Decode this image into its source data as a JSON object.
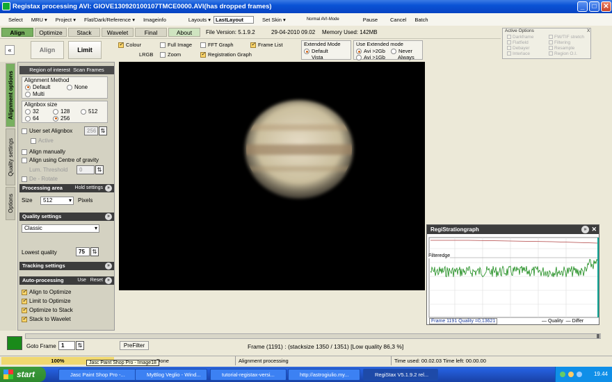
{
  "window": {
    "title": "Registax processing AVI: GIOVE130920100107TMCE0000.AVI(has dropped frames)",
    "min": "_",
    "max": "□",
    "close": "✕"
  },
  "menu": {
    "select": "Select",
    "mru": "MRU ▾",
    "project": "Project ▾",
    "flat": "Flat/Dark/Reference ▾",
    "imageinfo": "Imageinfo",
    "layouts": "Layouts ▾",
    "layout_value": "LastLayout",
    "setskin": "Set Skin ▾",
    "normal": "Normal AVI-Mode",
    "pause": "Pause",
    "cancel": "Cancel",
    "batch": "Batch"
  },
  "tabs": {
    "align": "Align",
    "optimize": "Optimize",
    "stack": "Stack",
    "wavelet": "Wavelet",
    "final": "Final",
    "about": "About",
    "version": "File Version: 5.1.9.2",
    "date": "29-04-2010 09.02",
    "memory": "Memory Used: 142MB"
  },
  "optbar": {
    "collapse": "«",
    "align_btn": "Align",
    "limit_btn": "Limit",
    "colour": "Colour",
    "fullimage": "Full Image",
    "fftgraph": "FFT Graph",
    "framelist": "Frame List",
    "lrgb": "LRGB",
    "zoom": "Zoom",
    "reggraph": "Registration Graph",
    "extmode": "Extended Mode",
    "default": "Default",
    "vista": "Vista",
    "useext": "Use  Extended mode",
    "avi2gb": "Avi >2Gb",
    "avi1gb": "Avi >1Gb",
    "never": "Never",
    "always": "Always"
  },
  "activeopts": {
    "title": "Active Options",
    "close": "X",
    "items": [
      "Darkframe",
      "FW/TIF stretch",
      "Flatfield",
      "Filtering",
      "Debayer",
      "Resample",
      "Interlace",
      "Region O.I."
    ]
  },
  "sidetabs": {
    "alignment": "Alignment options",
    "quality": "Quality settings",
    "options": "Options"
  },
  "panel": {
    "roi": "Region of interest",
    "scan": "Scan Frames",
    "align_method": "Alignment Method",
    "default": "Default",
    "none": "None",
    "multi": "Multi",
    "alignbox_size": "Alignbox size",
    "s32": "32",
    "s128": "128",
    "s512": "512",
    "s64": "64",
    "s256": "256",
    "user_alignbox": "User set Alignbox",
    "user_value": "256",
    "active": "Active",
    "align_manually": "Align manually",
    "align_cog": "Align using Centre of gravity",
    "lum_threshold": "Lum. Threshold",
    "lum_value": "0",
    "derotate": "De - Rotate",
    "processing_area": "Processing area",
    "hold": "Hold settings",
    "size": "Size",
    "size_value": "512",
    "pixels": "Pixels",
    "quality_settings": "Quality settings",
    "classic": "Classic",
    "lowest_quality": "Lowest quality",
    "lq_value": "75",
    "tracking": "Tracking settings",
    "autoproc": "Auto-processing",
    "use": "Use",
    "reset": "Reset",
    "a2o": "Align to Optimize",
    "l2o": "Limit to Optimize",
    "o2s": "Optimize to Stack",
    "s2w": "Stack to Wavelet"
  },
  "graph": {
    "title": "RegiStrationgraph",
    "filteredge": "Filteredge",
    "frame": "Frame 1191 Quality =0,13621",
    "legend_quality": "— Quality",
    "legend_diff": "— Differ"
  },
  "bottom": {
    "goto": "Goto Frame",
    "goto_value": "1",
    "prefilter": "PreFilter",
    "frameinfo": "Frame (1191) :  (stacksize 1350 / 1351) [Low quality 86,3 %]"
  },
  "status": {
    "percent": "100%",
    "done": "Done",
    "align": "Alignment processing",
    "time": "Time used: 00.02.03 Time left: 00.00.00",
    "tooltip": "Jasc Paint Shop Pro - Image18"
  },
  "taskbar": {
    "start": "start",
    "items": [
      "Jasc Paint Shop Pro -...",
      "MyBlog Veglio - Wind...",
      "tutorial-registax-versi...",
      "http://astrogiulio.my...",
      "RegiStax V5.1.9.2 rel..."
    ],
    "clock": "19.44"
  }
}
